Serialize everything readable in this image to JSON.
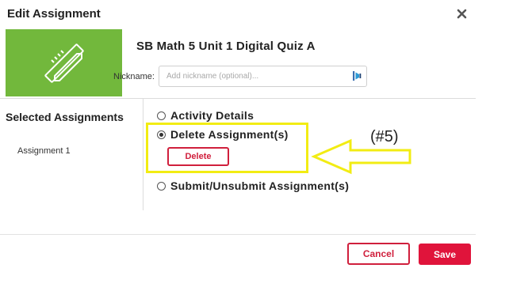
{
  "dialog": {
    "title": "Edit Assignment",
    "close_icon": "close-x-icon"
  },
  "assignment": {
    "name": "SB Math 5 Unit 1 Digital Quiz A",
    "thumbnail_icon": "pencil-ruler-icon",
    "thumbnail_color": "#72b83c"
  },
  "nickname": {
    "label": "Nickname:",
    "value": "",
    "placeholder": "Add nickname (optional)...",
    "reader_icon": "immersive-reader-icon"
  },
  "selected": {
    "title": "Selected Assignments",
    "items": [
      "Assignment 1"
    ]
  },
  "options": [
    {
      "label": "Activity Details",
      "selected": false
    },
    {
      "label": "Delete Assignment(s)",
      "selected": true
    },
    {
      "label": "Submit/Unsubmit Assignment(s)",
      "selected": false
    }
  ],
  "delete_button": {
    "label": "Delete"
  },
  "callout": {
    "label": "(#5)",
    "color": "#f2ec13"
  },
  "footer": {
    "cancel_label": "Cancel",
    "save_label": "Save"
  },
  "colors": {
    "accent": "#e0143b",
    "highlight": "#f2ec13"
  }
}
